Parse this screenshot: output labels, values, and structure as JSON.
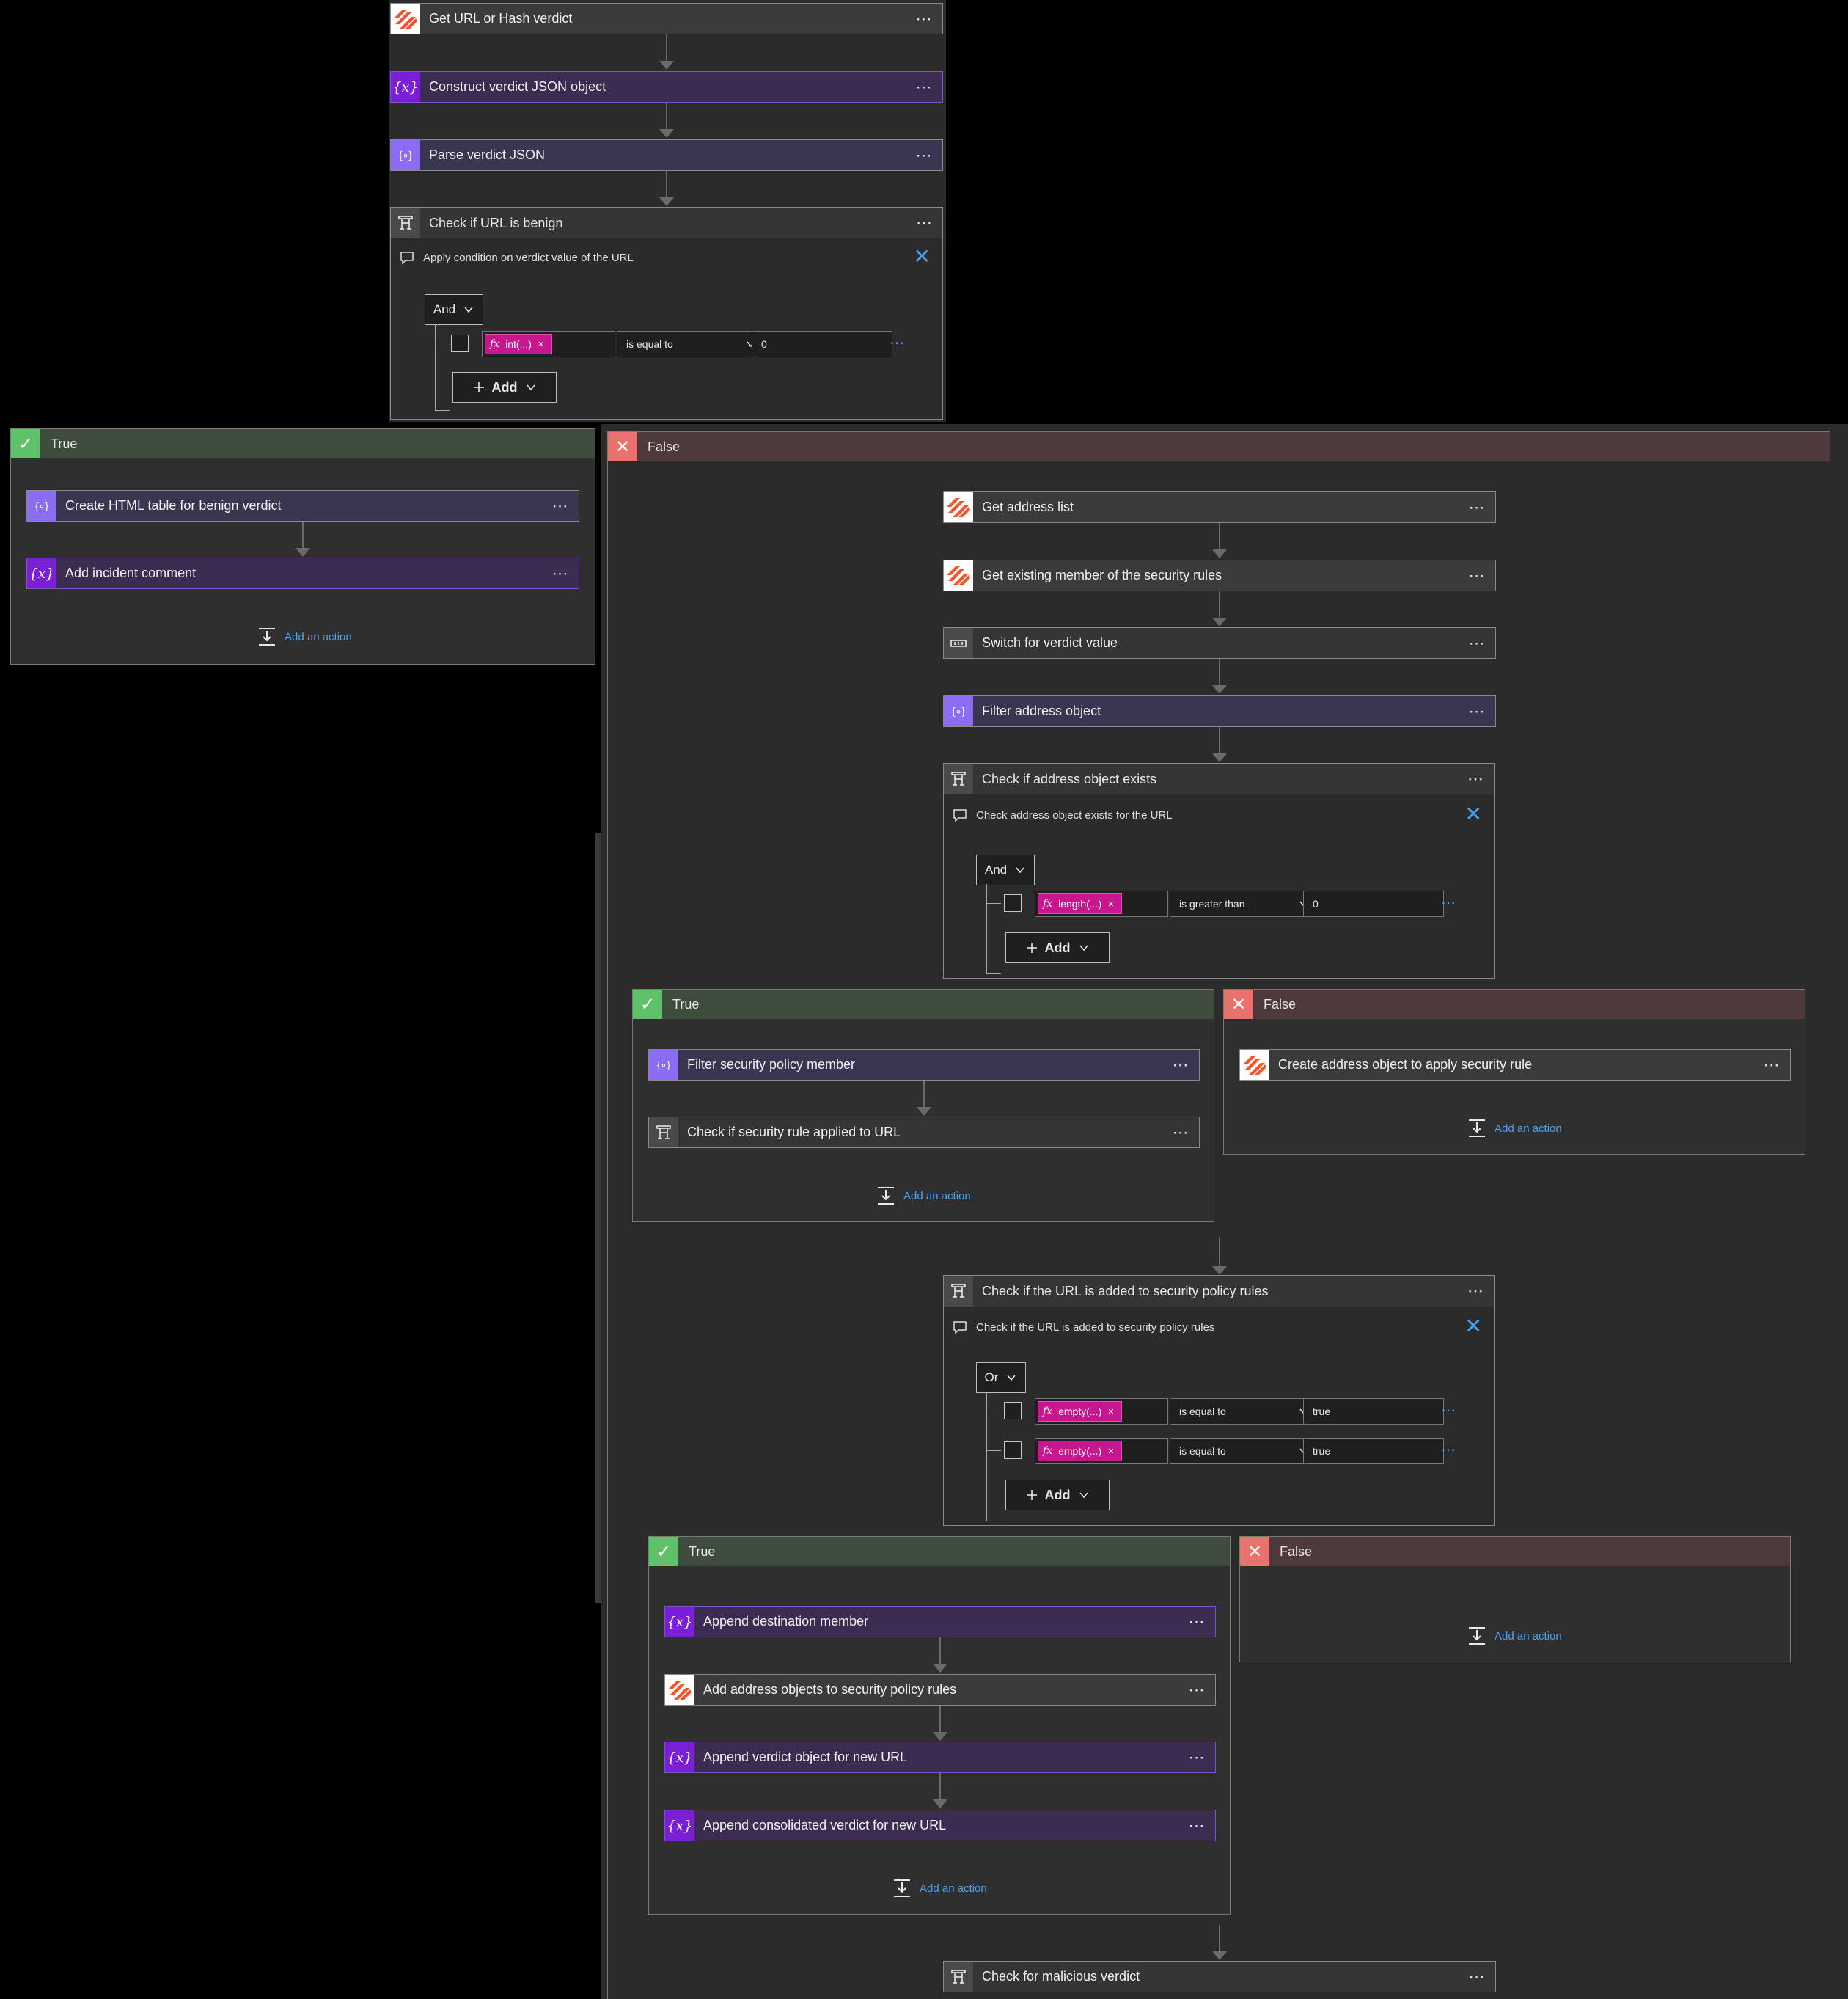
{
  "top": {
    "get_verdict": "Get URL or Hash verdict",
    "construct": "Construct verdict JSON object",
    "parse": "Parse verdict JSON",
    "check_benign": {
      "title": "Check if URL is benign",
      "note": "Apply condition on verdict value of the URL",
      "group": "And",
      "rows": [
        {
          "token": "int(...)",
          "operator": "is equal to",
          "value": "0"
        }
      ],
      "add": "Add"
    }
  },
  "true1": {
    "header": "True",
    "create_html": "Create HTML table for benign verdict",
    "add_comment": "Add incident comment",
    "add_action": "Add an action"
  },
  "false1": {
    "header": "False",
    "get_address_list": "Get address list",
    "get_existing": "Get existing member of the security rules",
    "switch": "Switch for verdict value",
    "filter_address": "Filter address object",
    "check_exists": {
      "title": "Check if address object exists",
      "note": "Check address object exists for the URL",
      "group": "And",
      "rows": [
        {
          "token": "length(...)",
          "operator": "is greater than",
          "value": "0"
        }
      ],
      "add": "Add"
    },
    "true2": {
      "header": "True",
      "filter_member": "Filter security policy member",
      "check_rule": "Check if security rule applied to URL",
      "add_action": "Add an action"
    },
    "false2": {
      "header": "False",
      "create_address": "Create address object to apply security rule",
      "add_action": "Add an action"
    },
    "check_added": {
      "title": "Check if the URL is added to security policy rules",
      "note": "Check if the URL is added to security policy rules",
      "group": "Or",
      "rows": [
        {
          "token": "empty(...)",
          "operator": "is equal to",
          "value": "true"
        },
        {
          "token": "empty(...)",
          "operator": "is equal to",
          "value": "true"
        }
      ],
      "add": "Add"
    },
    "true3": {
      "header": "True",
      "append_dest": "Append destination member",
      "add_objects": "Add address objects to security policy rules",
      "append_verdict": "Append verdict object for new URL",
      "append_consolidated": "Append consolidated verdict for new URL",
      "add_action": "Add an action"
    },
    "false3": {
      "header": "False",
      "add_action": "Add an action"
    },
    "check_malicious": "Check for malicious verdict"
  },
  "icons": {
    "more": "⋯",
    "close": "✕",
    "check": "✓",
    "var": "{x}",
    "data": "{∘}"
  },
  "colors": {
    "true_accent": "#5fc26a",
    "false_accent": "#e9726c",
    "variable_accent": "#7b1fd6",
    "data_op_accent": "#8b6cf2",
    "link": "#4aa3f0",
    "token": "#c8168f"
  }
}
